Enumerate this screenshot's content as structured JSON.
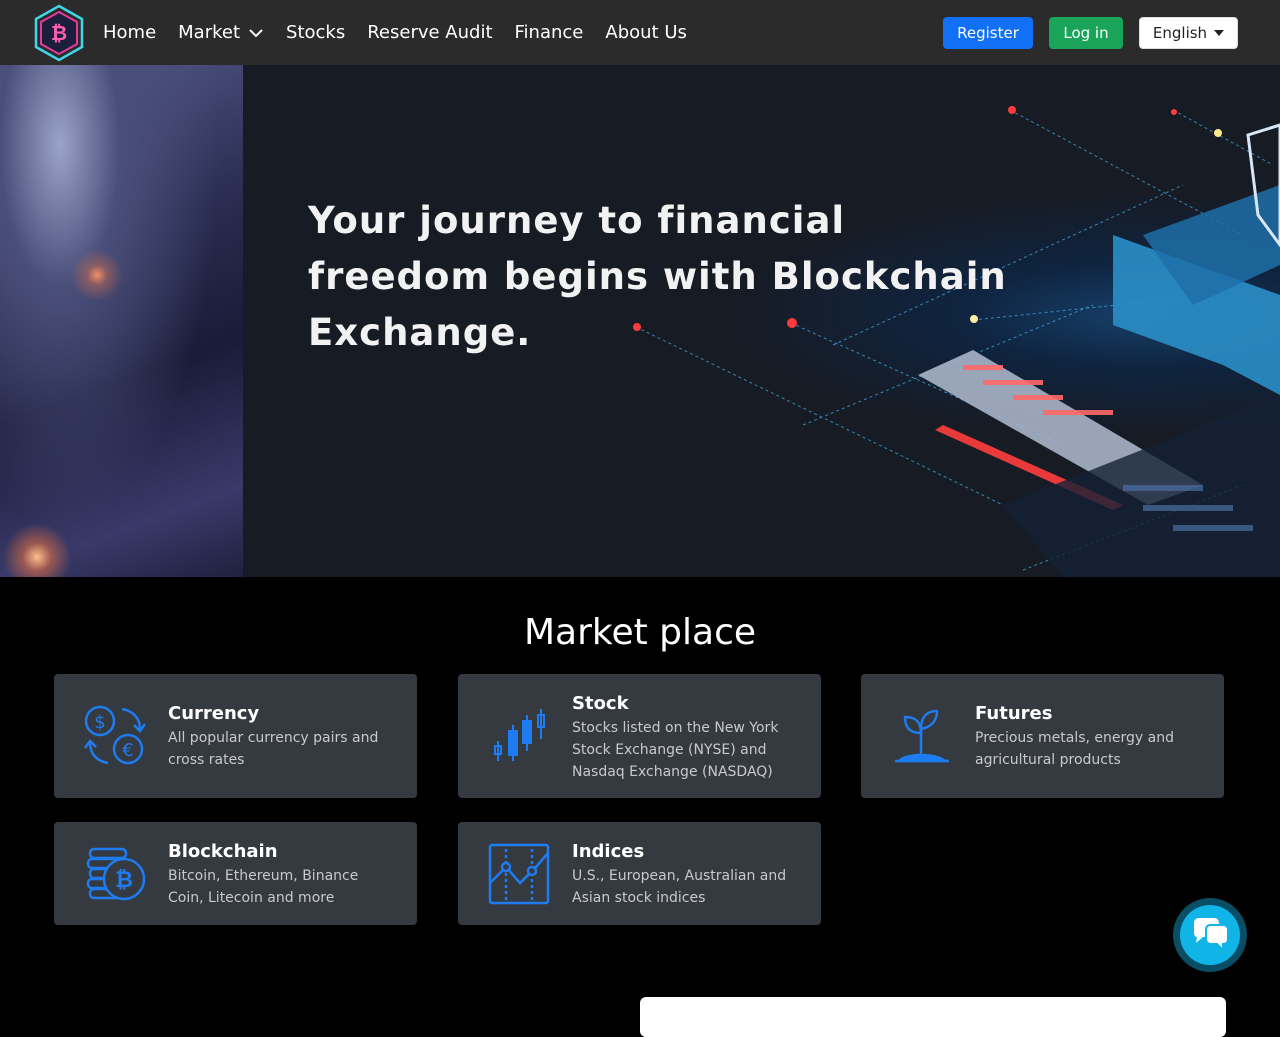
{
  "nav": {
    "links": [
      "Home",
      "Market",
      "Stocks",
      "Reserve Audit",
      "Finance",
      "About Us"
    ],
    "register_label": "Register",
    "login_label": "Log in",
    "language_label": "English",
    "logo_icon": "bitcoin-hexagon-icon"
  },
  "hero": {
    "title": "Your journey to financial freedom begins with Blockchain Exchange."
  },
  "market": {
    "title": "Market place",
    "cards": [
      {
        "title": "Currency",
        "desc": "All popular currency pairs and cross rates",
        "icon": "currency-exchange-icon"
      },
      {
        "title": "Stock",
        "desc": "Stocks listed on the New York Stock Exchange (NYSE) and Nasdaq Exchange (NASDAQ)",
        "icon": "candlestick-icon"
      },
      {
        "title": "Futures",
        "desc": "Precious metals, energy and agricultural products",
        "icon": "plant-sprout-icon"
      },
      {
        "title": "Blockchain",
        "desc": "Bitcoin, Ethereum, Binance Coin, Litecoin and more",
        "icon": "bitcoin-coins-icon"
      },
      {
        "title": "Indices",
        "desc": "U.S., European, Australian and Asian stock indices",
        "icon": "index-chart-icon"
      }
    ]
  },
  "colors": {
    "accent_blue": "#1170f5",
    "login_green": "#19a45a",
    "card_bg": "#353a40",
    "icon_blue": "#1e7cf0",
    "chat_cyan": "#10b4e6"
  },
  "chat": {
    "icon": "chat-bubbles-icon"
  }
}
